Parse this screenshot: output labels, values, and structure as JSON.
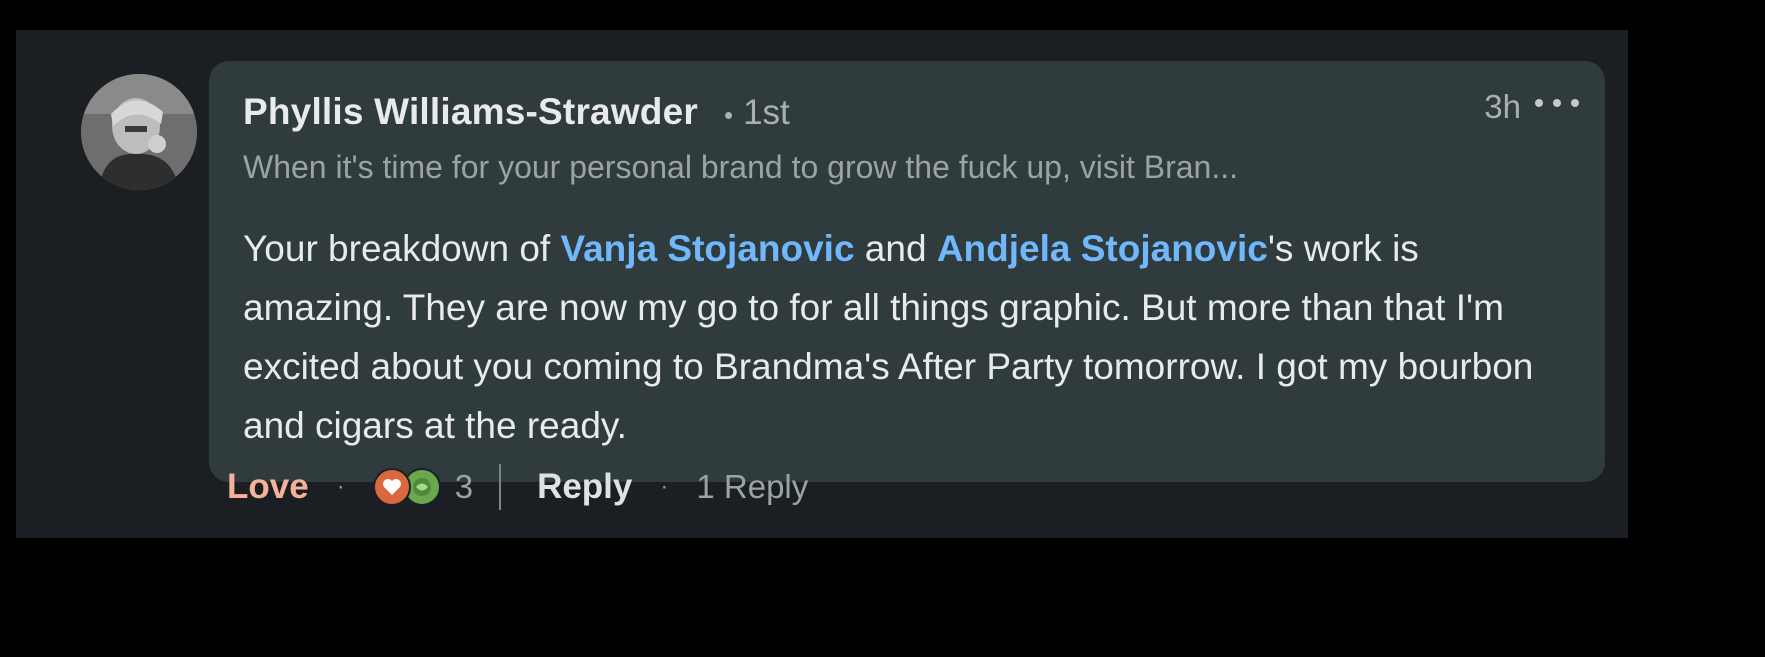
{
  "comment": {
    "author": {
      "name": "Phyllis Williams-Strawder",
      "separator": "•",
      "degree": "1st",
      "headline": "When it's time for your personal brand to grow the fuck up, visit Bran..."
    },
    "timestamp": "3h",
    "body": {
      "part1": "Your breakdown of ",
      "mention1": "Vanja Stojanovic",
      "part2": " and ",
      "mention2": "Andjela Stojanovic",
      "part3": "'s work is amazing. They are now my go to for all things graphic. But more than that I'm excited about you coming to Brandma's After Party tomorrow. I got my bourbon and cigars at the ready."
    }
  },
  "actions": {
    "love_label": "Love",
    "dot": "·",
    "reaction_count": "3",
    "reaction_icons": [
      "love-icon",
      "support-icon"
    ],
    "reply_label": "Reply",
    "replies_label": "1 Reply"
  },
  "colors": {
    "background": "#000000",
    "panel": "#1b1f23",
    "bubble": "#2f3b3d",
    "mention": "#71b7fb",
    "love": "#f5b19a"
  }
}
